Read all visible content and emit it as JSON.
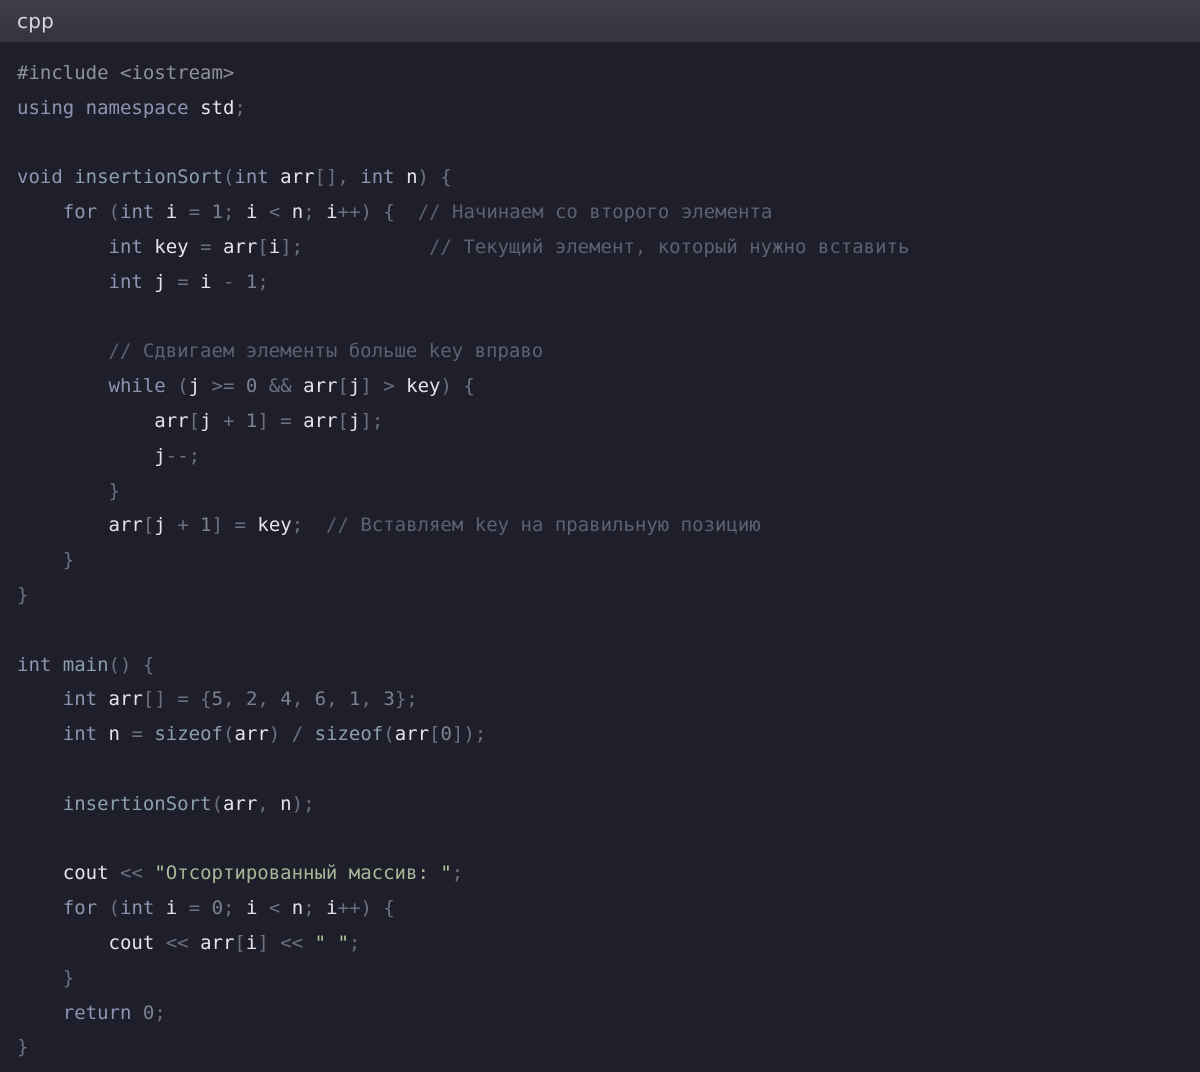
{
  "header": {
    "language": "cpp"
  },
  "colors": {
    "background": "#1e1f2b",
    "header_bg": "#363742",
    "keyword": "#8d95b3",
    "identifier": "#e4e4ea",
    "comment": "#5d6172",
    "string": "#a8b596",
    "number": "#7d8190"
  },
  "code": {
    "lines": [
      [
        [
          "pre",
          "#include <iostream>"
        ]
      ],
      [
        [
          "kw",
          "using"
        ],
        [
          "sp",
          " "
        ],
        [
          "kw",
          "namespace"
        ],
        [
          "sp",
          " "
        ],
        [
          "id",
          "std"
        ],
        [
          "punc",
          ";"
        ]
      ],
      [],
      [
        [
          "type",
          "void"
        ],
        [
          "sp",
          " "
        ],
        [
          "fn",
          "insertionSort"
        ],
        [
          "punc",
          "("
        ],
        [
          "type",
          "int"
        ],
        [
          "sp",
          " "
        ],
        [
          "id",
          "arr"
        ],
        [
          "punc",
          "[],"
        ],
        [
          "sp",
          " "
        ],
        [
          "type",
          "int"
        ],
        [
          "sp",
          " "
        ],
        [
          "id",
          "n"
        ],
        [
          "punc",
          ")"
        ],
        [
          "sp",
          " "
        ],
        [
          "punc",
          "{"
        ]
      ],
      [
        [
          "sp",
          "    "
        ],
        [
          "kw",
          "for"
        ],
        [
          "sp",
          " "
        ],
        [
          "punc",
          "("
        ],
        [
          "type",
          "int"
        ],
        [
          "sp",
          " "
        ],
        [
          "id",
          "i"
        ],
        [
          "sp",
          " "
        ],
        [
          "op",
          "="
        ],
        [
          "sp",
          " "
        ],
        [
          "num",
          "1"
        ],
        [
          "punc",
          ";"
        ],
        [
          "sp",
          " "
        ],
        [
          "id",
          "i"
        ],
        [
          "sp",
          " "
        ],
        [
          "op",
          "<"
        ],
        [
          "sp",
          " "
        ],
        [
          "id",
          "n"
        ],
        [
          "punc",
          ";"
        ],
        [
          "sp",
          " "
        ],
        [
          "id",
          "i"
        ],
        [
          "op",
          "++"
        ],
        [
          "punc",
          ")"
        ],
        [
          "sp",
          " "
        ],
        [
          "punc",
          "{"
        ],
        [
          "sp",
          "  "
        ],
        [
          "cmt",
          "// Начинаем со второго элемента"
        ]
      ],
      [
        [
          "sp",
          "        "
        ],
        [
          "type",
          "int"
        ],
        [
          "sp",
          " "
        ],
        [
          "id",
          "key"
        ],
        [
          "sp",
          " "
        ],
        [
          "op",
          "="
        ],
        [
          "sp",
          " "
        ],
        [
          "id",
          "arr"
        ],
        [
          "punc",
          "["
        ],
        [
          "id",
          "i"
        ],
        [
          "punc",
          "];"
        ],
        [
          "sp",
          "           "
        ],
        [
          "cmt",
          "// Текущий элемент, который нужно вставить"
        ]
      ],
      [
        [
          "sp",
          "        "
        ],
        [
          "type",
          "int"
        ],
        [
          "sp",
          " "
        ],
        [
          "id",
          "j"
        ],
        [
          "sp",
          " "
        ],
        [
          "op",
          "="
        ],
        [
          "sp",
          " "
        ],
        [
          "id",
          "i"
        ],
        [
          "sp",
          " "
        ],
        [
          "op",
          "-"
        ],
        [
          "sp",
          " "
        ],
        [
          "num",
          "1"
        ],
        [
          "punc",
          ";"
        ]
      ],
      [],
      [
        [
          "sp",
          "        "
        ],
        [
          "cmt",
          "// Сдвигаем элементы больше key вправо"
        ]
      ],
      [
        [
          "sp",
          "        "
        ],
        [
          "kw",
          "while"
        ],
        [
          "sp",
          " "
        ],
        [
          "punc",
          "("
        ],
        [
          "id",
          "j"
        ],
        [
          "sp",
          " "
        ],
        [
          "op",
          ">="
        ],
        [
          "sp",
          " "
        ],
        [
          "num",
          "0"
        ],
        [
          "sp",
          " "
        ],
        [
          "op",
          "&&"
        ],
        [
          "sp",
          " "
        ],
        [
          "id",
          "arr"
        ],
        [
          "punc",
          "["
        ],
        [
          "id",
          "j"
        ],
        [
          "punc",
          "]"
        ],
        [
          "sp",
          " "
        ],
        [
          "op",
          ">"
        ],
        [
          "sp",
          " "
        ],
        [
          "id",
          "key"
        ],
        [
          "punc",
          ")"
        ],
        [
          "sp",
          " "
        ],
        [
          "punc",
          "{"
        ]
      ],
      [
        [
          "sp",
          "            "
        ],
        [
          "id",
          "arr"
        ],
        [
          "punc",
          "["
        ],
        [
          "id",
          "j"
        ],
        [
          "sp",
          " "
        ],
        [
          "op",
          "+"
        ],
        [
          "sp",
          " "
        ],
        [
          "num",
          "1"
        ],
        [
          "punc",
          "]"
        ],
        [
          "sp",
          " "
        ],
        [
          "op",
          "="
        ],
        [
          "sp",
          " "
        ],
        [
          "id",
          "arr"
        ],
        [
          "punc",
          "["
        ],
        [
          "id",
          "j"
        ],
        [
          "punc",
          "];"
        ]
      ],
      [
        [
          "sp",
          "            "
        ],
        [
          "id",
          "j"
        ],
        [
          "op",
          "--"
        ],
        [
          "punc",
          ";"
        ]
      ],
      [
        [
          "sp",
          "        "
        ],
        [
          "punc",
          "}"
        ]
      ],
      [
        [
          "sp",
          "        "
        ],
        [
          "id",
          "arr"
        ],
        [
          "punc",
          "["
        ],
        [
          "id",
          "j"
        ],
        [
          "sp",
          " "
        ],
        [
          "op",
          "+"
        ],
        [
          "sp",
          " "
        ],
        [
          "num",
          "1"
        ],
        [
          "punc",
          "]"
        ],
        [
          "sp",
          " "
        ],
        [
          "op",
          "="
        ],
        [
          "sp",
          " "
        ],
        [
          "id",
          "key"
        ],
        [
          "punc",
          ";"
        ],
        [
          "sp",
          "  "
        ],
        [
          "cmt",
          "// Вставляем key на правильную позицию"
        ]
      ],
      [
        [
          "sp",
          "    "
        ],
        [
          "punc",
          "}"
        ]
      ],
      [
        [
          "punc",
          "}"
        ]
      ],
      [],
      [
        [
          "type",
          "int"
        ],
        [
          "sp",
          " "
        ],
        [
          "fn",
          "main"
        ],
        [
          "punc",
          "()"
        ],
        [
          "sp",
          " "
        ],
        [
          "punc",
          "{"
        ]
      ],
      [
        [
          "sp",
          "    "
        ],
        [
          "type",
          "int"
        ],
        [
          "sp",
          " "
        ],
        [
          "id",
          "arr"
        ],
        [
          "punc",
          "[]"
        ],
        [
          "sp",
          " "
        ],
        [
          "op",
          "="
        ],
        [
          "sp",
          " "
        ],
        [
          "punc",
          "{"
        ],
        [
          "num",
          "5"
        ],
        [
          "punc",
          ","
        ],
        [
          "sp",
          " "
        ],
        [
          "num",
          "2"
        ],
        [
          "punc",
          ","
        ],
        [
          "sp",
          " "
        ],
        [
          "num",
          "4"
        ],
        [
          "punc",
          ","
        ],
        [
          "sp",
          " "
        ],
        [
          "num",
          "6"
        ],
        [
          "punc",
          ","
        ],
        [
          "sp",
          " "
        ],
        [
          "num",
          "1"
        ],
        [
          "punc",
          ","
        ],
        [
          "sp",
          " "
        ],
        [
          "num",
          "3"
        ],
        [
          "punc",
          "};"
        ]
      ],
      [
        [
          "sp",
          "    "
        ],
        [
          "type",
          "int"
        ],
        [
          "sp",
          " "
        ],
        [
          "id",
          "n"
        ],
        [
          "sp",
          " "
        ],
        [
          "op",
          "="
        ],
        [
          "sp",
          " "
        ],
        [
          "fn",
          "sizeof"
        ],
        [
          "punc",
          "("
        ],
        [
          "id",
          "arr"
        ],
        [
          "punc",
          ")"
        ],
        [
          "sp",
          " "
        ],
        [
          "op",
          "/"
        ],
        [
          "sp",
          " "
        ],
        [
          "fn",
          "sizeof"
        ],
        [
          "punc",
          "("
        ],
        [
          "id",
          "arr"
        ],
        [
          "punc",
          "["
        ],
        [
          "num",
          "0"
        ],
        [
          "punc",
          "]);"
        ]
      ],
      [],
      [
        [
          "sp",
          "    "
        ],
        [
          "fn",
          "insertionSort"
        ],
        [
          "punc",
          "("
        ],
        [
          "id",
          "arr"
        ],
        [
          "punc",
          ","
        ],
        [
          "sp",
          " "
        ],
        [
          "id",
          "n"
        ],
        [
          "punc",
          ");"
        ]
      ],
      [],
      [
        [
          "sp",
          "    "
        ],
        [
          "id",
          "cout"
        ],
        [
          "sp",
          " "
        ],
        [
          "op",
          "<<"
        ],
        [
          "sp",
          " "
        ],
        [
          "str-b",
          "\""
        ],
        [
          "str",
          "Отсортированный массив: "
        ],
        [
          "str-b",
          "\""
        ],
        [
          "punc",
          ";"
        ]
      ],
      [
        [
          "sp",
          "    "
        ],
        [
          "kw",
          "for"
        ],
        [
          "sp",
          " "
        ],
        [
          "punc",
          "("
        ],
        [
          "type",
          "int"
        ],
        [
          "sp",
          " "
        ],
        [
          "id",
          "i"
        ],
        [
          "sp",
          " "
        ],
        [
          "op",
          "="
        ],
        [
          "sp",
          " "
        ],
        [
          "num",
          "0"
        ],
        [
          "punc",
          ";"
        ],
        [
          "sp",
          " "
        ],
        [
          "id",
          "i"
        ],
        [
          "sp",
          " "
        ],
        [
          "op",
          "<"
        ],
        [
          "sp",
          " "
        ],
        [
          "id",
          "n"
        ],
        [
          "punc",
          ";"
        ],
        [
          "sp",
          " "
        ],
        [
          "id",
          "i"
        ],
        [
          "op",
          "++"
        ],
        [
          "punc",
          ")"
        ],
        [
          "sp",
          " "
        ],
        [
          "punc",
          "{"
        ]
      ],
      [
        [
          "sp",
          "        "
        ],
        [
          "id",
          "cout"
        ],
        [
          "sp",
          " "
        ],
        [
          "op",
          "<<"
        ],
        [
          "sp",
          " "
        ],
        [
          "id",
          "arr"
        ],
        [
          "punc",
          "["
        ],
        [
          "id",
          "i"
        ],
        [
          "punc",
          "]"
        ],
        [
          "sp",
          " "
        ],
        [
          "op",
          "<<"
        ],
        [
          "sp",
          " "
        ],
        [
          "str-b",
          "\" \""
        ],
        [
          "punc",
          ";"
        ]
      ],
      [
        [
          "sp",
          "    "
        ],
        [
          "punc",
          "}"
        ]
      ],
      [
        [
          "sp",
          "    "
        ],
        [
          "kw",
          "return"
        ],
        [
          "sp",
          " "
        ],
        [
          "num",
          "0"
        ],
        [
          "punc",
          ";"
        ]
      ],
      [
        [
          "punc",
          "}"
        ]
      ]
    ]
  }
}
